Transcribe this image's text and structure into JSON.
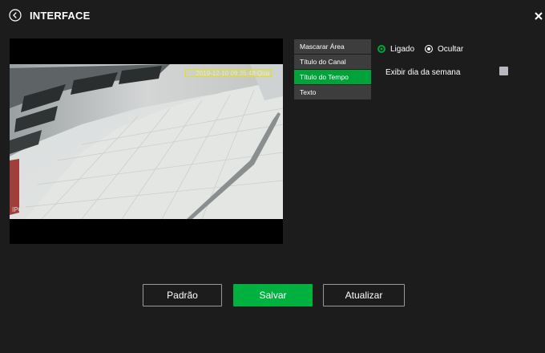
{
  "header": {
    "title": "INTERFACE",
    "back_icon": "chevron-left-circle-icon",
    "close_icon": "close-icon"
  },
  "video": {
    "time_overlay": "2019-12-10 09:35:48 Qua",
    "channel_overlay": "IPC"
  },
  "menu": {
    "items": [
      {
        "label": "Mascarar Área",
        "active": false
      },
      {
        "label": "Título do Canal",
        "active": false
      },
      {
        "label": "Título do Tempo",
        "active": true
      },
      {
        "label": "Texto",
        "active": false
      }
    ]
  },
  "settings": {
    "radio_on_label": "Ligado",
    "radio_hide_label": "Ocultar",
    "weekday_label": "Exibir dia da semana"
  },
  "buttons": {
    "default_label": "Padrão",
    "save_label": "Salvar",
    "refresh_label": "Atualizar"
  },
  "colors": {
    "accent": "#00a33a",
    "background": "#1c1c1c",
    "menu_item": "#3d3d3d"
  }
}
